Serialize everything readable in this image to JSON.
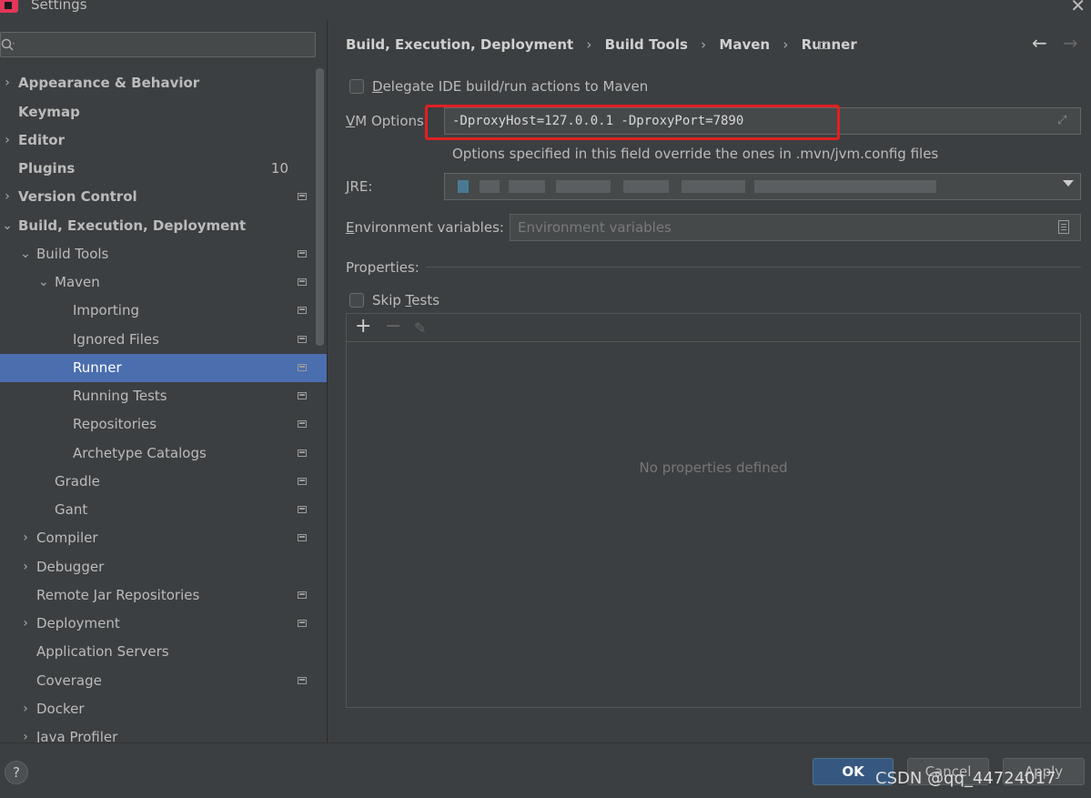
{
  "window": {
    "title": "Settings"
  },
  "search": {
    "placeholder": ""
  },
  "sidebar": {
    "items": [
      {
        "label": "Appearance & Behavior",
        "arrow": "›"
      },
      {
        "label": "Keymap"
      },
      {
        "label": "Editor",
        "arrow": "›"
      },
      {
        "label": "Plugins",
        "badge": "10"
      },
      {
        "label": "Version Control",
        "arrow": "›"
      },
      {
        "label": "Build, Execution, Deployment",
        "arrow": "⌄"
      },
      {
        "label": "Build Tools",
        "arrow": "⌄"
      },
      {
        "label": "Maven",
        "arrow": "⌄"
      },
      {
        "label": "Importing"
      },
      {
        "label": "Ignored Files"
      },
      {
        "label": "Runner"
      },
      {
        "label": "Running Tests"
      },
      {
        "label": "Repositories"
      },
      {
        "label": "Archetype Catalogs"
      },
      {
        "label": "Gradle"
      },
      {
        "label": "Gant"
      },
      {
        "label": "Compiler",
        "arrow": "›"
      },
      {
        "label": "Debugger",
        "arrow": "›"
      },
      {
        "label": "Remote Jar Repositories"
      },
      {
        "label": "Deployment",
        "arrow": "›"
      },
      {
        "label": "Application Servers"
      },
      {
        "label": "Coverage"
      },
      {
        "label": "Docker",
        "arrow": "›"
      },
      {
        "label": "Java Profiler",
        "arrow": "›"
      }
    ]
  },
  "breadcrumb": {
    "items": [
      "Build, Execution, Deployment",
      "Build Tools",
      "Maven",
      "Runner"
    ],
    "separator": "›"
  },
  "nav": {
    "back": "←",
    "forward": "→"
  },
  "runner": {
    "delegate_label_first": "D",
    "delegate_label_rest": "elegate IDE build/run actions to Maven",
    "vm_label_first": "V",
    "vm_label_rest": "M Options",
    "vm_value": "-DproxyHost=127.0.0.1 -DproxyPort=7890",
    "vm_hint": "Options specified in this field override the ones in .mvn/jvm.config files",
    "jre_label_first": "J",
    "jre_label_rest": "RE:",
    "env_label_first": "E",
    "env_label_rest": "nvironment variables:",
    "env_placeholder": "Environment variables",
    "properties_label": "Properties:",
    "skip_label_first": "Skip ",
    "skip_label_ul": "T",
    "skip_label_rest": "ests",
    "toolbar": {
      "add": "+",
      "remove": "−",
      "edit": "✎"
    },
    "empty_text": "No properties defined"
  },
  "footer": {
    "help": "?",
    "ok_label": "OK",
    "cancel_label": "Cancel",
    "apply_label": "Apply",
    "watermark": "CSDN @qq_44724017"
  },
  "colors": {
    "selection": "#4b6eaf",
    "highlight_box": "#e02020",
    "ok_button": "#365880",
    "background": "#3c3f41"
  }
}
